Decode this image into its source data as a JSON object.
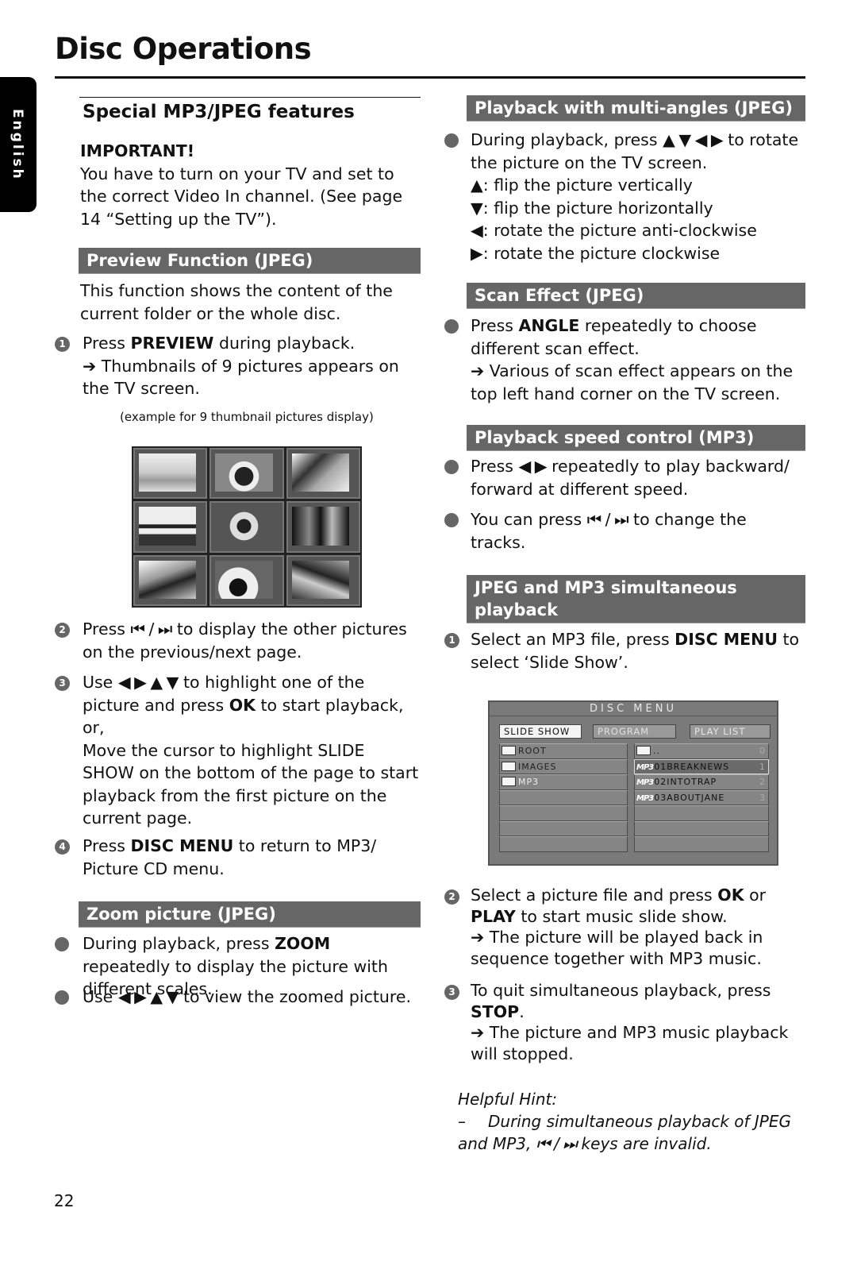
{
  "page": {
    "title": "Disc Operations",
    "language_tab": "English",
    "page_number": "22"
  },
  "left": {
    "subtitle": "Special MP3/JPEG features",
    "important_label": "IMPORTANT!",
    "important_text": "You have to turn on your TV and set to the correct Video In channel.  (See page 14 “Setting up the TV”).",
    "preview": {
      "heading": "Preview Function (JPEG)",
      "intro": "This function shows the content of the current folder or the whole disc.",
      "step1": {
        "num": "1",
        "pre": "Press ",
        "key": "PREVIEW",
        "post": " during playback.",
        "result": "➔ Thumbnails of 9 pictures appears on the TV screen."
      },
      "caption": "(example for 9 thumbnail pictures display)",
      "step2": {
        "num": "2",
        "pre": "Press ",
        "keys": "⏮ / ⏭",
        "post": " to display the other pictures on the previous/next page."
      },
      "step3": {
        "num": "3",
        "pre": "Use ",
        "keys": "◀ ▶ ▲ ▼",
        "mid": " to highlight one of the picture and press ",
        "key": "OK",
        "post": " to start playback, or,",
        "extra": "Move the cursor to highlight SLIDE SHOW on the bottom of the page to start playback from the first picture on the current page."
      },
      "step4": {
        "num": "4",
        "pre": "Press ",
        "key": "DISC MENU",
        "post": " to return to MP3/ Picture CD menu."
      }
    },
    "zoom": {
      "heading": "Zoom picture (JPEG)",
      "bullet1": {
        "pre": "During playback, press ",
        "key": "ZOOM",
        "post": " repeatedly to display the picture with different scales."
      },
      "bullet2": {
        "pre": "Use ",
        "keys": "◀ ▶ ▲ ▼",
        "post": " to view the zoomed picture."
      }
    }
  },
  "right": {
    "multi_angles": {
      "heading": "Playback with multi-angles (JPEG)",
      "bullet": {
        "pre": "During playback, press ",
        "keys": "▲ ▼ ◀ ▶",
        "post": " to rotate the picture on the TV screen."
      },
      "lines": [
        {
          "sym": "▲",
          "text": ": flip the picture vertically"
        },
        {
          "sym": "▼",
          "text": ": flip the picture horizontally"
        },
        {
          "sym": "◀",
          "text": ": rotate the picture anti-clockwise"
        },
        {
          "sym": "▶",
          "text": ": rotate the picture clockwise"
        }
      ]
    },
    "scan": {
      "heading": "Scan Effect (JPEG)",
      "bullet": {
        "pre": "Press ",
        "key": "ANGLE",
        "post": " repeatedly to choose different scan effect.",
        "result": "➔ Various of scan effect appears on the top left hand corner on the TV screen."
      }
    },
    "speed": {
      "heading": "Playback speed control (MP3)",
      "bullet1": {
        "pre": "Press ",
        "keys": "◀ ▶",
        "post": " repeatedly to play backward/ forward at different speed."
      },
      "bullet2": {
        "pre": "You can press ",
        "keys": "⏮ / ⏭",
        "post": " to change the tracks."
      }
    },
    "simultaneous": {
      "heading": "JPEG and MP3 simultaneous playback",
      "step1": {
        "num": "1",
        "pre": "Select an MP3 file, press ",
        "key": "DISC MENU",
        "post": " to select ‘Slide Show’."
      },
      "disc_menu": {
        "title": "DISC MENU",
        "tabs": [
          "SLIDE SHOW",
          "PROGRAM",
          "PLAY LIST"
        ],
        "folders": [
          "ROOT",
          "IMAGES",
          "MP3",
          "",
          "",
          "",
          ""
        ],
        "files": [
          {
            "type": "folder",
            "name": "..",
            "num": "0"
          },
          {
            "type": "mp3",
            "badge": "MP3",
            "name": "01BREAKNEWS",
            "num": "1"
          },
          {
            "type": "mp3",
            "badge": "MP3",
            "name": "02INTOTRAP",
            "num": "2"
          },
          {
            "type": "mp3",
            "badge": "MP3",
            "name": "03ABOUTJANE",
            "num": "3"
          },
          {
            "type": "empty",
            "name": "",
            "num": ""
          },
          {
            "type": "empty",
            "name": "",
            "num": ""
          },
          {
            "type": "empty",
            "name": "",
            "num": ""
          }
        ]
      },
      "step2": {
        "num": "2",
        "pre": "Select a picture file and press ",
        "key": "OK",
        "mid": " or ",
        "key2": "PLAY",
        "post": " to start music slide show.",
        "result": "➔ The picture will be played back in sequence together with MP3 music."
      },
      "step3": {
        "num": "3",
        "pre": "To quit simultaneous playback, press ",
        "key": "STOP",
        "post": ".",
        "result": "➔ The picture and MP3 music playback will stopped."
      },
      "hint": {
        "title": "Helpful Hint:",
        "dash": "–",
        "line1": "During simultaneous playback of JPEG",
        "line2_pre": "and MP3, ",
        "keys": "⏮ / ⏭",
        "line2_post": " keys are invalid."
      }
    }
  }
}
